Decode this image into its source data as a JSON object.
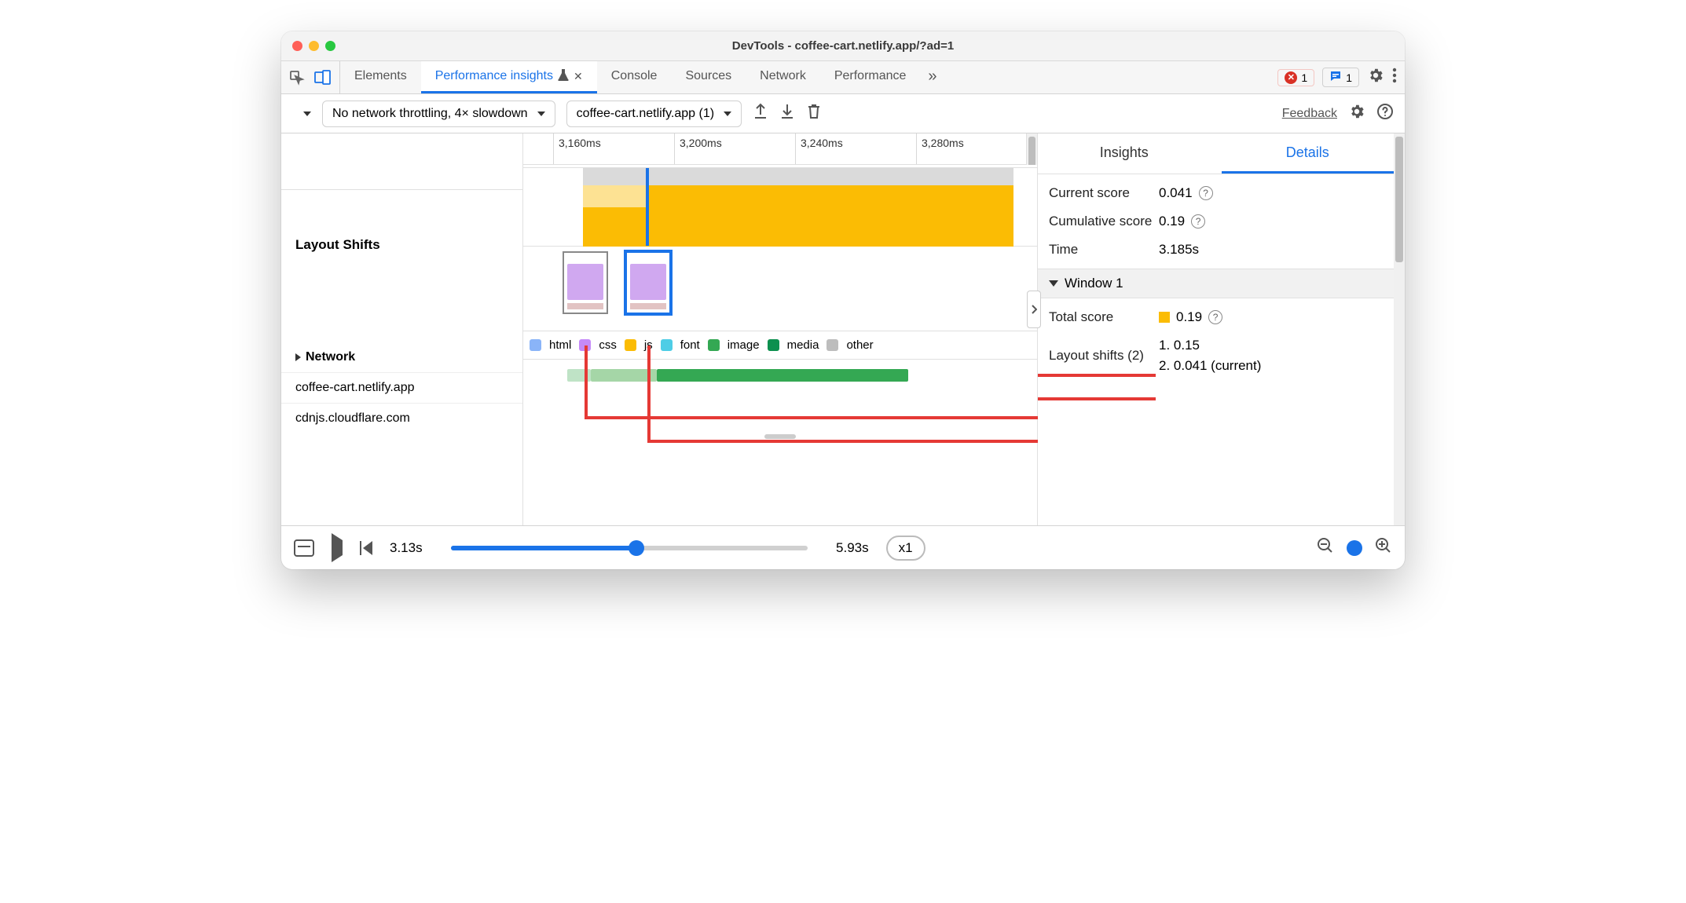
{
  "window_title": "DevTools - coffee-cart.netlify.app/?ad=1",
  "tabstrip": {
    "tabs": [
      "Elements",
      "Performance insights",
      "Console",
      "Sources",
      "Network",
      "Performance"
    ],
    "active_index": 1,
    "error_badge": "1",
    "message_badge": "1"
  },
  "toolbar": {
    "throttling": "No network throttling, 4× slowdown",
    "recording": "coffee-cart.netlify.app (1)",
    "feedback": "Feedback"
  },
  "ruler": {
    "ticks": [
      "3,160ms",
      "3,200ms",
      "3,240ms",
      "3,280ms"
    ]
  },
  "left_panel": {
    "layout_shifts_title": "Layout Shifts",
    "network_title": "Network",
    "hosts": [
      "coffee-cart.netlify.app",
      "cdnjs.cloudflare.com"
    ]
  },
  "legend": {
    "items": [
      {
        "label": "html",
        "color": "#8ab4f8"
      },
      {
        "label": "css",
        "color": "#c58af9"
      },
      {
        "label": "js",
        "color": "#fbbc04"
      },
      {
        "label": "font",
        "color": "#4ecde6"
      },
      {
        "label": "image",
        "color": "#34a853"
      },
      {
        "label": "media",
        "color": "#0d904f"
      },
      {
        "label": "other",
        "color": "#bdbdbd"
      }
    ]
  },
  "details": {
    "tabs": [
      "Insights",
      "Details"
    ],
    "active_tab": 1,
    "current_score": "0.041",
    "cumulative_score": "0.19",
    "time": "3.185s",
    "window_section": "Window 1",
    "total_score": "0.19",
    "layout_shifts_label": "Layout shifts (2)",
    "shifts": [
      "1. 0.15",
      "2. 0.041 (current)"
    ],
    "labels": {
      "current": "Current score",
      "cumulative": "Cumulative score",
      "time": "Time",
      "total": "Total score"
    }
  },
  "footer": {
    "start_time": "3.13s",
    "end_time": "5.93s",
    "speed": "x1",
    "play_pos_pct": 52,
    "zoom_pos_pct": 72
  }
}
